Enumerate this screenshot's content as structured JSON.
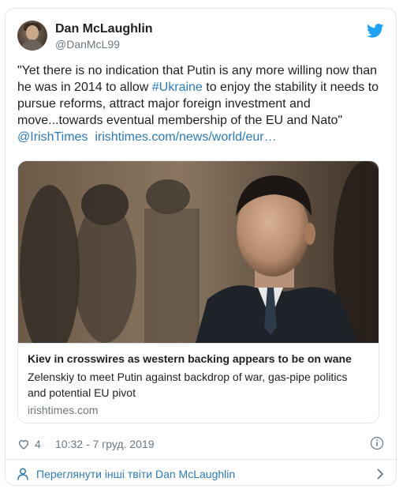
{
  "tweet": {
    "author_name": "Dan McLaughlin",
    "author_handle": "@DanMcL99",
    "text_before": "\"Yet there is no indication that Putin is any more willing now than he was in 2014 to allow ",
    "hashtag": "#Ukraine",
    "text_after": " to enjoy the stability it needs to pursue reforms, attract major foreign investment and move...towards eventual membership of the EU and Nato\"",
    "mention": "@IrishTimes",
    "url": "irishtimes.com/news/world/eur…"
  },
  "preview": {
    "title": "Kiev in crosswires as western backing appears to be on wane",
    "description": "Zelenskiy to meet Putin against backdrop of war, gas-pipe politics and potential EU pivot",
    "domain": "irishtimes.com"
  },
  "meta": {
    "likes": "4",
    "timestamp": "10:32 - 7 груд. 2019"
  },
  "footer": {
    "label": "Переглянути інші твіти Dan McLaughlin"
  },
  "colors": {
    "link": "#2b7bb9",
    "text": "#1c2022",
    "muted": "#697882",
    "border": "#e1e8ed",
    "twitter_blue": "#1da1f2"
  },
  "icons": {
    "brand": "twitter-bird-icon",
    "like": "heart-icon",
    "info": "info-icon",
    "profile": "person-icon",
    "more": "chevron-right-icon"
  }
}
